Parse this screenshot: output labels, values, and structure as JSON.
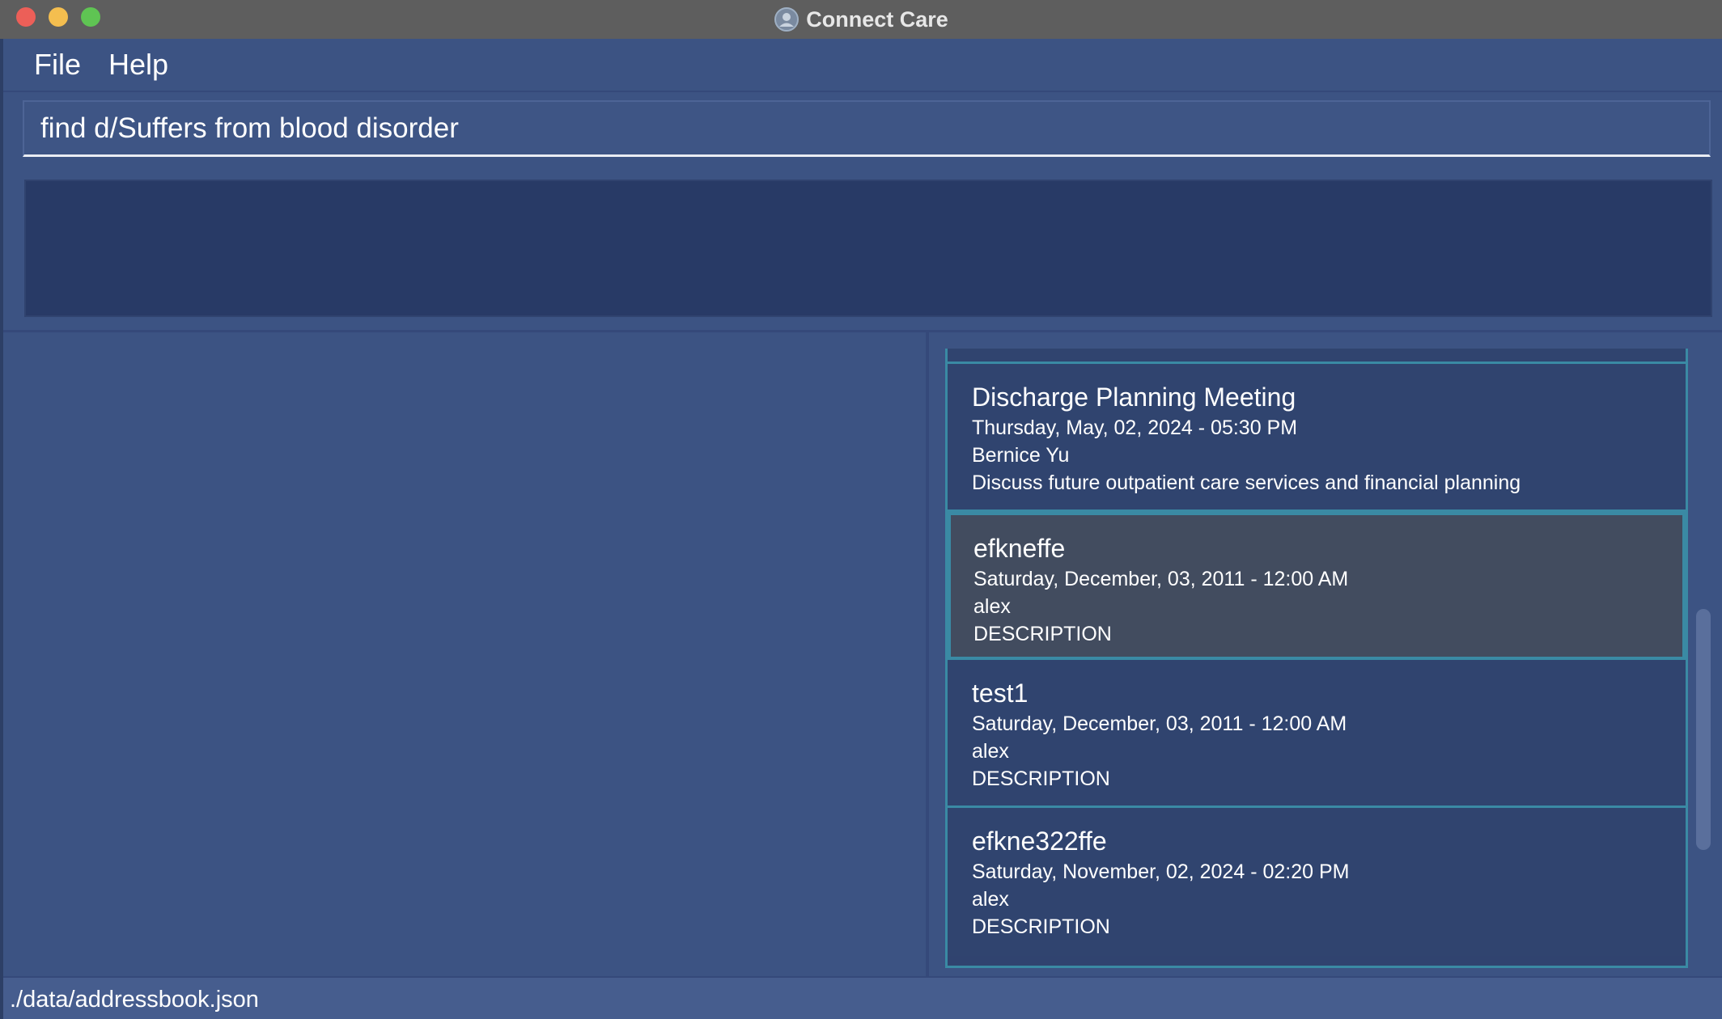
{
  "window": {
    "title": "Connect Care",
    "icon": "app-logo-icon"
  },
  "menu": {
    "items": [
      {
        "label": "File"
      },
      {
        "label": "Help"
      }
    ]
  },
  "command": {
    "value": "find d/Suffers from blood disorder"
  },
  "result": {
    "text": ""
  },
  "appointments": [
    {
      "title": "Discharge Planning Meeting",
      "datetime": "Thursday, May, 02, 2024 - 05:30 PM",
      "person": "Bernice Yu",
      "description": "Discuss future outpatient care services and financial planning",
      "selected": false
    },
    {
      "title": "efkneffe",
      "datetime": "Saturday, December, 03, 2011 - 12:00 AM",
      "person": "alex",
      "description": "DESCRIPTION",
      "selected": true
    },
    {
      "title": "test1",
      "datetime": "Saturday, December, 03, 2011 - 12:00 AM",
      "person": "alex",
      "description": "DESCRIPTION",
      "selected": false
    },
    {
      "title": "efkne322ffe",
      "datetime": "Saturday, November, 02, 2024 - 02:20 PM",
      "person": "alex",
      "description": "DESCRIPTION",
      "selected": false
    }
  ],
  "status": {
    "path": "./data/addressbook.json"
  },
  "colors": {
    "background": "#3c5383",
    "result_bg": "#283a66",
    "card_bg": "#30446f",
    "card_selected_bg": "#424c5f",
    "card_border": "#3a8aa4",
    "close": "#ec5f58",
    "minimize": "#f4be4f",
    "maximize": "#5fc453"
  }
}
